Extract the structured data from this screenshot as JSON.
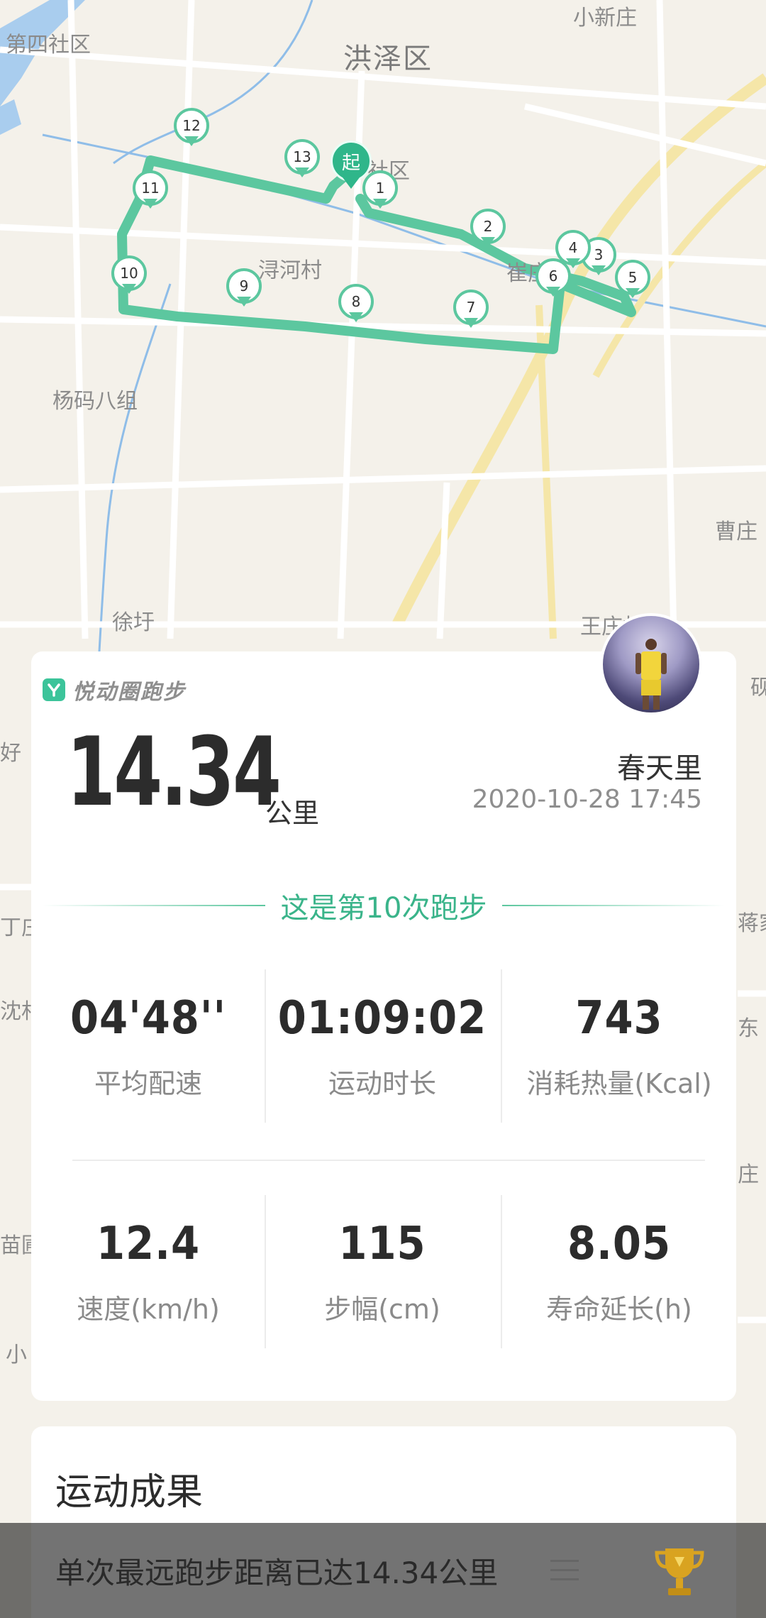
{
  "map": {
    "labels": {
      "district": "洪泽区",
      "l1": "第四社区",
      "l2": "小新庄",
      "l3": "社区",
      "l4": "浔河村",
      "l5": "崔庄",
      "l6": "杨码八组",
      "l7": "曹庄",
      "l8": "徐圩",
      "l9": "王庄村",
      "l10": "砚",
      "l11": "好",
      "l12": "丁庄",
      "l13": "蒋家",
      "l14": "沈村",
      "l15": "庄",
      "l16": "苗圃",
      "l17": "小",
      "l18": "东"
    },
    "start_label": "起",
    "waypoints": [
      "1",
      "2",
      "3",
      "4",
      "5",
      "6",
      "7",
      "8",
      "9",
      "10",
      "11",
      "12",
      "13"
    ]
  },
  "card": {
    "brand": "悦动圈跑步",
    "distance": "14.34",
    "unit": "公里",
    "user_name": "春天里",
    "datetime": "2020-10-28 17:45",
    "run_count_text": "这是第10次跑步",
    "stats": [
      {
        "value": "04'48''",
        "label": "平均配速"
      },
      {
        "value": "01:09:02",
        "label": "运动时长"
      },
      {
        "value": "743",
        "label": "消耗热量(Kcal)"
      },
      {
        "value": "12.4",
        "label": "速度(km/h)"
      },
      {
        "value": "115",
        "label": "步幅(cm)"
      },
      {
        "value": "8.05",
        "label": "寿命延长(h)"
      }
    ]
  },
  "results": {
    "title": "运动成果",
    "toast": "单次最远跑步距离已达14.34公里"
  },
  "colors": {
    "route": "#5cc79f",
    "accent": "#3ab48a",
    "brand": "#3cc49a"
  },
  "icons": {
    "logo": "yuedong-logo-icon",
    "avatar": "avatar",
    "menu": "menu-icon",
    "trophy": "trophy-icon"
  }
}
